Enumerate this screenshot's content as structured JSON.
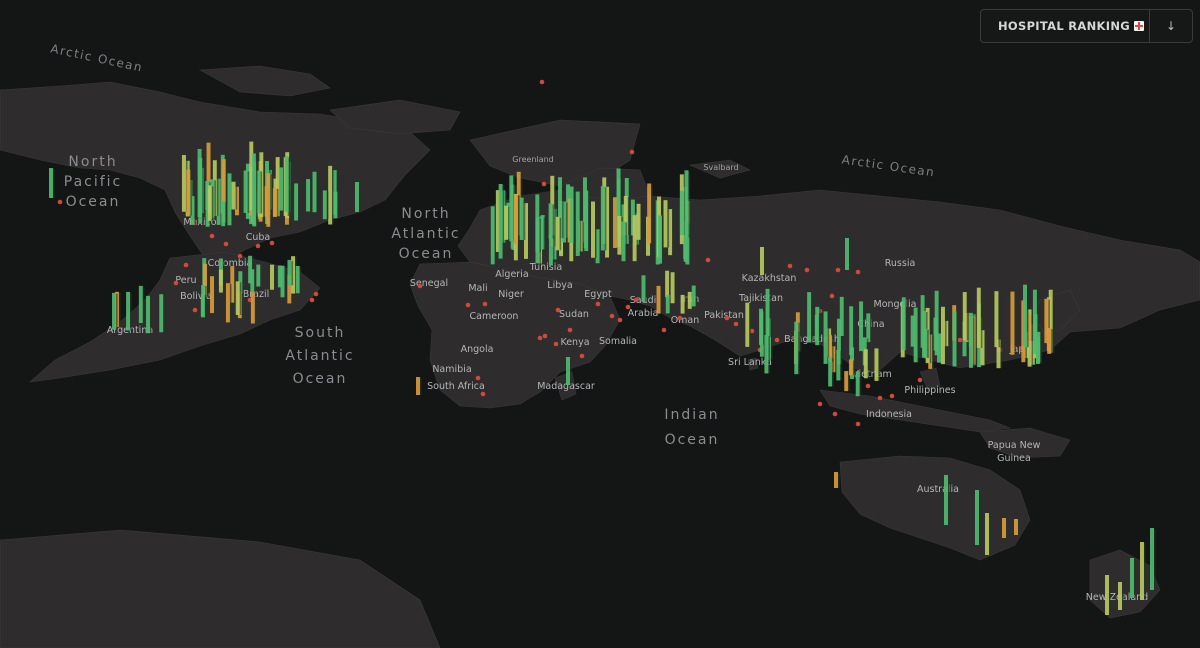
{
  "control": {
    "title": "HOSPITAL RANKING",
    "title_icon": "hospital-icon",
    "sort_button": "↓"
  },
  "colors": {
    "background": "#141515",
    "land": "#2e2c2c",
    "bar_high": "#4fba6f",
    "bar_mid": "#b7c75f",
    "bar_low": "#d89a3c",
    "hospital_dot": "#d04a3a"
  },
  "ocean_labels": [
    {
      "lines": [
        "Arctic Ocean"
      ]
    },
    {
      "lines": [
        "North",
        "Pacific",
        "Ocean"
      ]
    },
    {
      "lines": [
        "North",
        "Atlantic",
        "Ocean"
      ]
    },
    {
      "lines": [
        "South",
        "Atlantic",
        "Ocean"
      ]
    },
    {
      "lines": [
        "Indian",
        "Ocean"
      ]
    },
    {
      "lines": [
        "Arctic Ocean"
      ]
    }
  ],
  "place_labels": [
    "Greenland",
    "Svalbard",
    "Mexico",
    "Cuba",
    "Colombia",
    "Peru",
    "Bolivia",
    "Brazil",
    "Argentina",
    "Senegal",
    "Mali",
    "Algeria",
    "Niger",
    "Libya",
    "Tunisia",
    "Egypt",
    "Sudan",
    "Cameroon",
    "Angola",
    "Namibia",
    "South Africa",
    "Kenya",
    "Somalia",
    "Madagascar",
    "Saudi Arabia",
    "Oman",
    "Iran",
    "Kazakhstan",
    "Tajikistan",
    "Pakistan",
    "Russia",
    "Mongolia",
    "China",
    "Bangladesh",
    "Sri Lanka",
    "Vietnam",
    "Philippines",
    "Japan",
    "Indonesia",
    "Papua New Guinea",
    "Australia",
    "New Zealand"
  ]
}
